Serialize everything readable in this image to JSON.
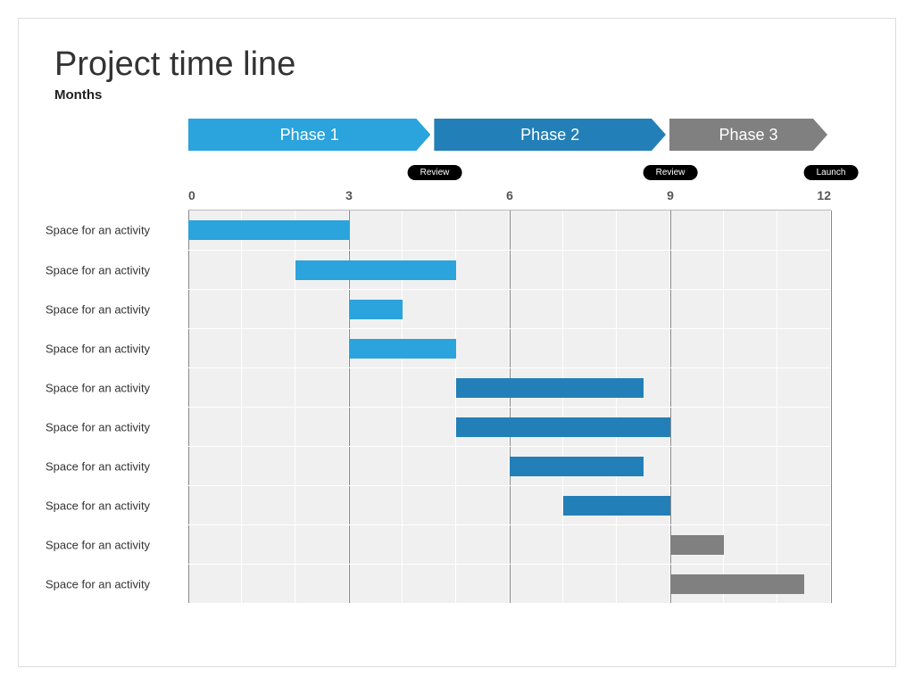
{
  "title": "Project time line",
  "subtitle": "Months",
  "phases": [
    {
      "label": "Phase 1",
      "start": 0,
      "end": 4.6,
      "color": "c1"
    },
    {
      "label": "Phase 2",
      "start": 4.6,
      "end": 9,
      "color": "c2"
    },
    {
      "label": "Phase 3",
      "start": 9,
      "end": 12,
      "color": "c3"
    }
  ],
  "milestones": [
    {
      "label": "Review",
      "month": 4.6
    },
    {
      "label": "Review",
      "month": 9
    },
    {
      "label": "Launch",
      "month": 12
    }
  ],
  "ticks": [
    0,
    3,
    6,
    9,
    12
  ],
  "vlines": [
    0,
    3,
    6,
    9,
    12
  ],
  "rows": [
    {
      "label": "Space for an activity",
      "start": 0,
      "end": 3,
      "color": "c1"
    },
    {
      "label": "Space for an activity",
      "start": 2,
      "end": 5,
      "color": "c1"
    },
    {
      "label": "Space for an activity",
      "start": 3,
      "end": 4,
      "color": "c1"
    },
    {
      "label": "Space for an activity",
      "start": 3,
      "end": 5,
      "color": "c1"
    },
    {
      "label": "Space for an activity",
      "start": 5,
      "end": 8.5,
      "color": "c2"
    },
    {
      "label": "Space for an activity",
      "start": 5,
      "end": 9,
      "color": "c2"
    },
    {
      "label": "Space for an activity",
      "start": 6,
      "end": 8.5,
      "color": "c2"
    },
    {
      "label": "Space for an activity",
      "start": 7,
      "end": 9,
      "color": "c2"
    },
    {
      "label": "Space for an activity",
      "start": 9,
      "end": 10,
      "color": "c3"
    },
    {
      "label": "Space for an activity",
      "start": 9,
      "end": 11.5,
      "color": "c3"
    }
  ],
  "chart_data": {
    "type": "bar",
    "title": "Project time line",
    "xlabel": "Months",
    "ylabel": "",
    "xlim": [
      0,
      12
    ],
    "x_ticks": [
      0,
      3,
      6,
      9,
      12
    ],
    "phases": [
      {
        "name": "Phase 1",
        "start": 0,
        "end": 4.6
      },
      {
        "name": "Phase 2",
        "start": 4.6,
        "end": 9
      },
      {
        "name": "Phase 3",
        "start": 9,
        "end": 12
      }
    ],
    "milestones": [
      {
        "name": "Review",
        "month": 4.6
      },
      {
        "name": "Review",
        "month": 9
      },
      {
        "name": "Launch",
        "month": 12
      }
    ],
    "series": [
      {
        "name": "Space for an activity",
        "start": 0,
        "end": 3,
        "phase": "Phase 1"
      },
      {
        "name": "Space for an activity",
        "start": 2,
        "end": 5,
        "phase": "Phase 1"
      },
      {
        "name": "Space for an activity",
        "start": 3,
        "end": 4,
        "phase": "Phase 1"
      },
      {
        "name": "Space for an activity",
        "start": 3,
        "end": 5,
        "phase": "Phase 1"
      },
      {
        "name": "Space for an activity",
        "start": 5,
        "end": 8.5,
        "phase": "Phase 2"
      },
      {
        "name": "Space for an activity",
        "start": 5,
        "end": 9,
        "phase": "Phase 2"
      },
      {
        "name": "Space for an activity",
        "start": 6,
        "end": 8.5,
        "phase": "Phase 2"
      },
      {
        "name": "Space for an activity",
        "start": 7,
        "end": 9,
        "phase": "Phase 2"
      },
      {
        "name": "Space for an activity",
        "start": 9,
        "end": 10,
        "phase": "Phase 3"
      },
      {
        "name": "Space for an activity",
        "start": 9,
        "end": 11.5,
        "phase": "Phase 3"
      }
    ]
  }
}
